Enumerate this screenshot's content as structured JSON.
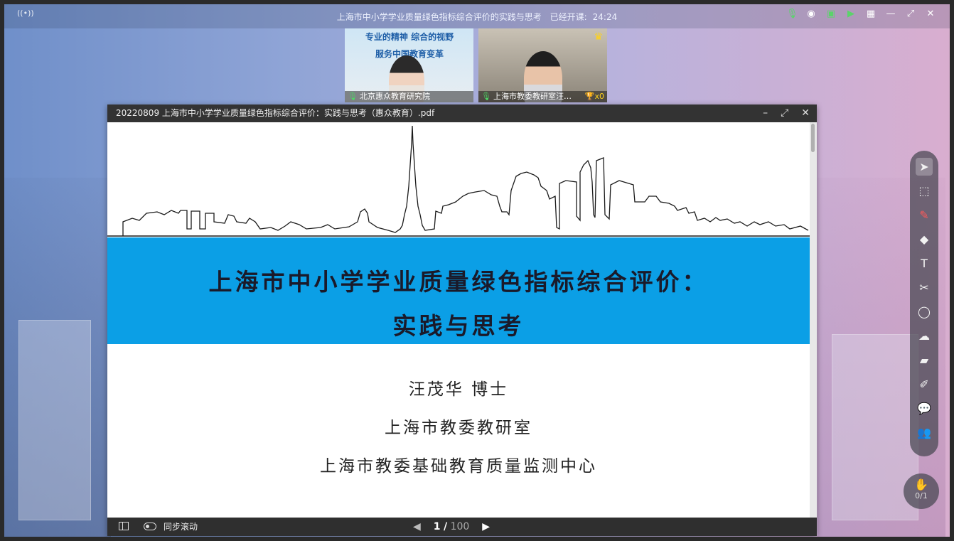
{
  "topbar": {
    "broadcast_icon": "((•))",
    "class_title": "上海市中小学学业质量绿色指标综合评价的实践与思考",
    "elapsed_label": "已经开课:",
    "elapsed_time": "24:24"
  },
  "video_tiles": [
    {
      "poster_line1": "专业的精神  综合的视野",
      "poster_line2": "服务中国教育变革",
      "name": "北京惠众教育研究院"
    },
    {
      "name": "上海市教委教研室汪…",
      "trophy": "x0"
    }
  ],
  "pdf": {
    "filename": "20220809  上海市中小学学业质量绿色指标综合评价：实践与思考（惠众教育）.pdf",
    "title_line1": "上海市中小学学业质量绿色指标综合评价：",
    "title_line2": "实践与思考",
    "author": "汪茂华 博士",
    "affiliation1": "上海市教委教研室",
    "affiliation2": "上海市教委基础教育质量监测中心",
    "sync_scroll_label": "同步滚动",
    "page_current": "1",
    "page_sep": "/",
    "page_total": "100"
  },
  "toolbar": {
    "counter": "0/1"
  },
  "colors": {
    "title_band": "#0b9fe6",
    "accent_green": "#5ad46a"
  }
}
